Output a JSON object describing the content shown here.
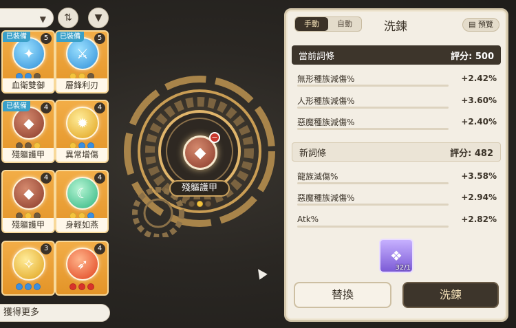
{
  "left": {
    "cards": [
      {
        "name": "血衛雙御",
        "level": "5",
        "equipped": "已裝備",
        "gem": "blue",
        "dots": [
          "d-blue",
          "d-blue",
          "d-brown"
        ]
      },
      {
        "name": "層鋒利刃",
        "level": "5",
        "equipped": "已裝備",
        "gem": "blue",
        "dots": [
          "d-gold",
          "d-gold",
          "d-brown"
        ]
      },
      {
        "name": "殘軀護甲",
        "level": "4",
        "equipped": "已裝備",
        "gem": "red",
        "dots": [
          "d-brown",
          "d-brown",
          "d-gold"
        ]
      },
      {
        "name": "異常增傷",
        "level": "4",
        "equipped": "",
        "gem": "yellow",
        "dots": [
          "d-gold",
          "d-blue",
          "d-blue"
        ]
      },
      {
        "name": "殘軀護甲",
        "level": "4",
        "equipped": "",
        "gem": "red",
        "dots": [
          "d-brown",
          "d-gold",
          "d-brown"
        ]
      },
      {
        "name": "身輕如燕",
        "level": "4",
        "equipped": "",
        "gem": "green",
        "dots": [
          "d-gold",
          "d-gold",
          "d-blue"
        ]
      },
      {
        "name": "",
        "level": "3",
        "equipped": "",
        "gem": "yellow",
        "dots": [
          "d-blue",
          "d-blue",
          "d-blue"
        ]
      },
      {
        "name": "",
        "level": "4",
        "equipped": "",
        "gem": "orange",
        "dots": [
          "d-red",
          "d-red",
          "d-red"
        ]
      }
    ],
    "get_more": "獲得更多"
  },
  "center": {
    "label": "殘軀護甲"
  },
  "panel": {
    "mode_manual": "手動",
    "mode_auto": "自動",
    "title": "洗鍊",
    "preview": "預覽",
    "current": {
      "heading": "當前詞條",
      "score": "評分: 500",
      "stats": [
        {
          "name": "無形種族減傷%",
          "value": "+2.42%"
        },
        {
          "name": "人形種族減傷%",
          "value": "+3.60%"
        },
        {
          "name": "惡魔種族減傷%",
          "value": "+2.40%"
        }
      ]
    },
    "new": {
      "heading": "新詞條",
      "score": "評分: 482",
      "stats": [
        {
          "name": "龍族減傷%",
          "value": "+3.58%"
        },
        {
          "name": "惡魔種族減傷%",
          "value": "+2.94%"
        },
        {
          "name": "Atk%",
          "value": "+2.82%"
        }
      ]
    },
    "material_count": "32/1",
    "swap": "替換",
    "refine": "洗鍊"
  }
}
